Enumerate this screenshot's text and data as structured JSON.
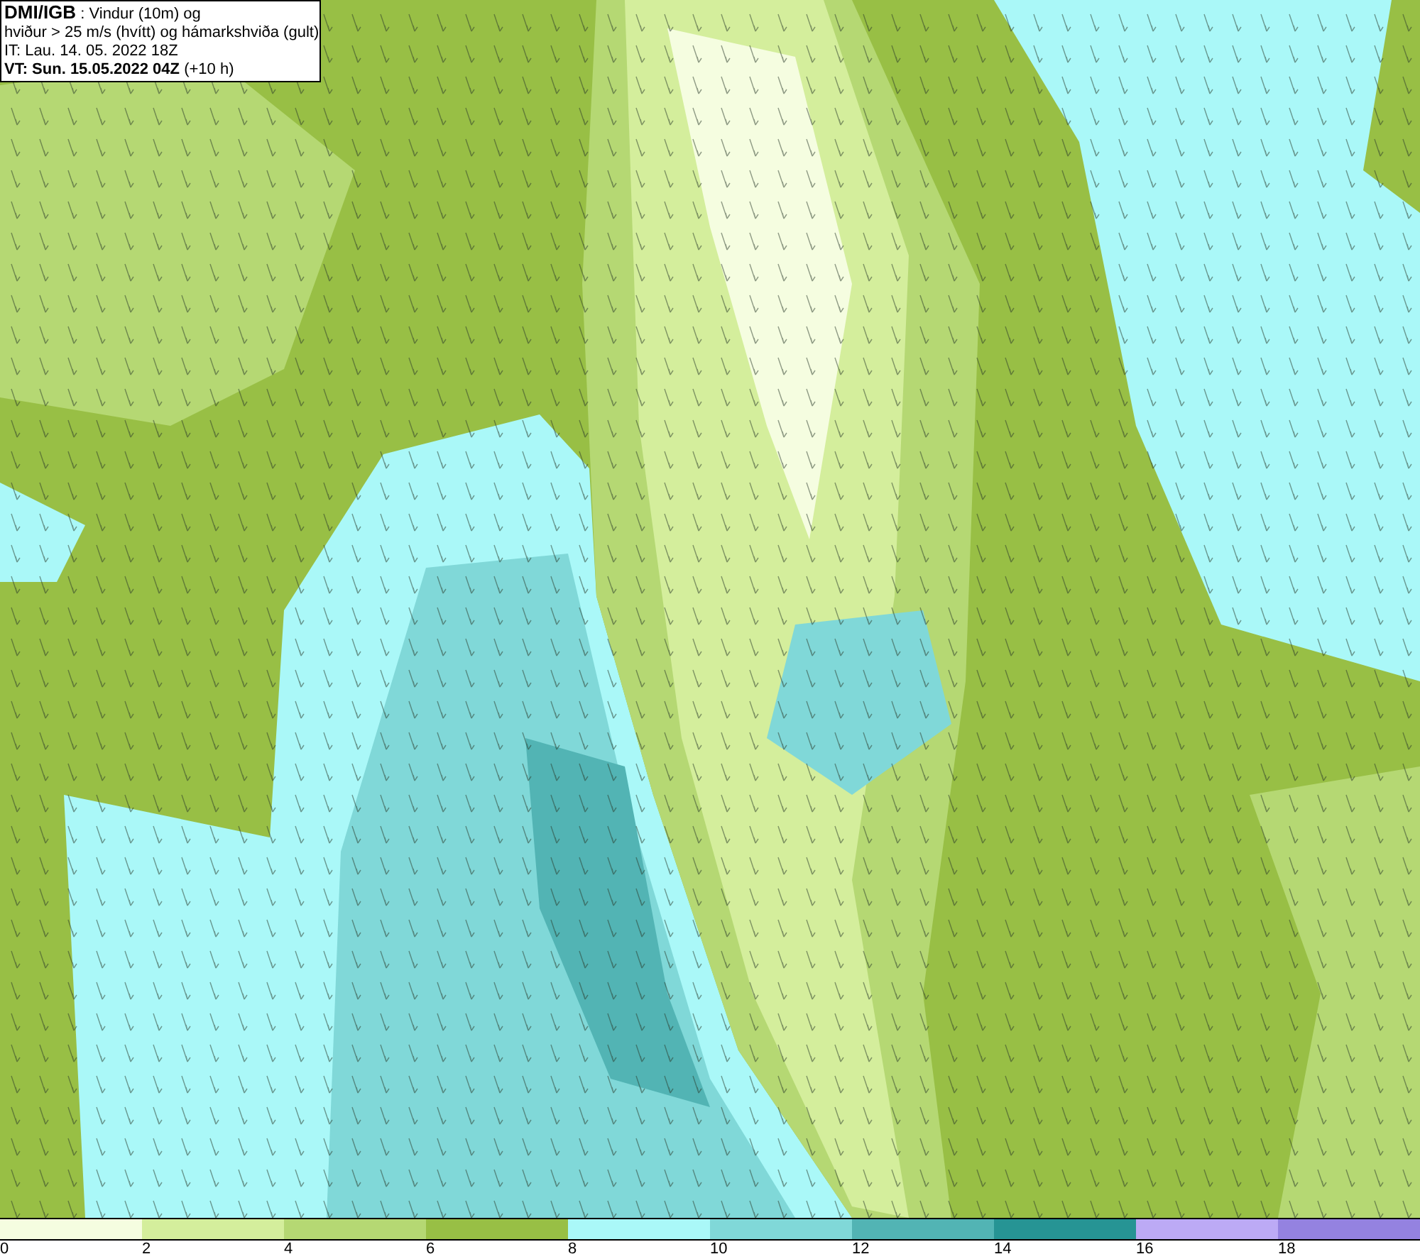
{
  "header": {
    "lines": [
      "**DMI/IGB** : Vindur (10m) og",
      "hviður > 25 m/s (hvítt) og hámarkshviða (gult)",
      "IT: Lau. 14. 05. 2022 18Z",
      "**VT: Sun. 15.05.2022 04Z** (+10 h)"
    ]
  },
  "legend": [
    {
      "label": "0",
      "color": "#f5fde0"
    },
    {
      "label": "2",
      "color": "#d4ee9c"
    },
    {
      "label": "4",
      "color": "#b5d873"
    },
    {
      "label": "6",
      "color": "#98bf45"
    },
    {
      "label": "8",
      "color": "#aaf8f8"
    },
    {
      "label": "10",
      "color": "#80d8d8"
    },
    {
      "label": "12",
      "color": "#52b4b4"
    },
    {
      "label": "14",
      "color": "#269494"
    },
    {
      "label": "16",
      "color": "#bcaaf5"
    },
    {
      "label": "18",
      "color": "#9482e0"
    }
  ]
}
